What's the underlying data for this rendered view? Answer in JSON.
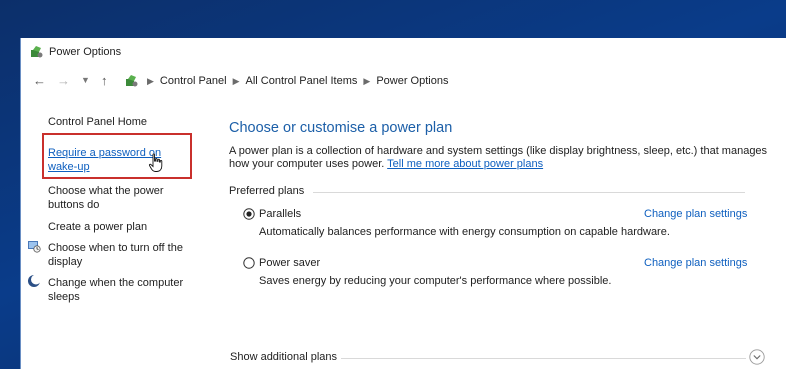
{
  "window": {
    "title": "Power Options"
  },
  "address_bar": {
    "breadcrumbs": [
      "Control Panel",
      "All Control Panel Items",
      "Power Options"
    ]
  },
  "sidebar": {
    "home": "Control Panel Home",
    "items": [
      {
        "label_line1": "Require a password on",
        "label_line2": "wake-up"
      },
      {
        "label_line1": "Choose what the power",
        "label_line2": "buttons do"
      },
      {
        "label_line1": "Create a power plan"
      },
      {
        "label_line1": "Choose when to turn off the",
        "label_line2": "display"
      },
      {
        "label_line1": "Change when the computer",
        "label_line2": "sleeps"
      }
    ]
  },
  "main": {
    "heading": "Choose or customise a power plan",
    "description": "A power plan is a collection of hardware and system settings (like display brightness, sleep, etc.) that manages how your computer uses power.",
    "description_link": "Tell me more about power plans",
    "preferred_label": "Preferred plans",
    "plans": [
      {
        "name": "Parallels",
        "selected": true,
        "description": "Automatically balances performance with energy consumption on capable hardware.",
        "link": "Change plan settings"
      },
      {
        "name": "Power saver",
        "selected": false,
        "description": "Saves energy by reducing your computer's performance where possible.",
        "link": "Change plan settings"
      }
    ],
    "show_additional": "Show additional plans"
  },
  "colors": {
    "link": "#0e5fbf",
    "heading": "#1c5fa8",
    "highlight": "#c9302c"
  }
}
